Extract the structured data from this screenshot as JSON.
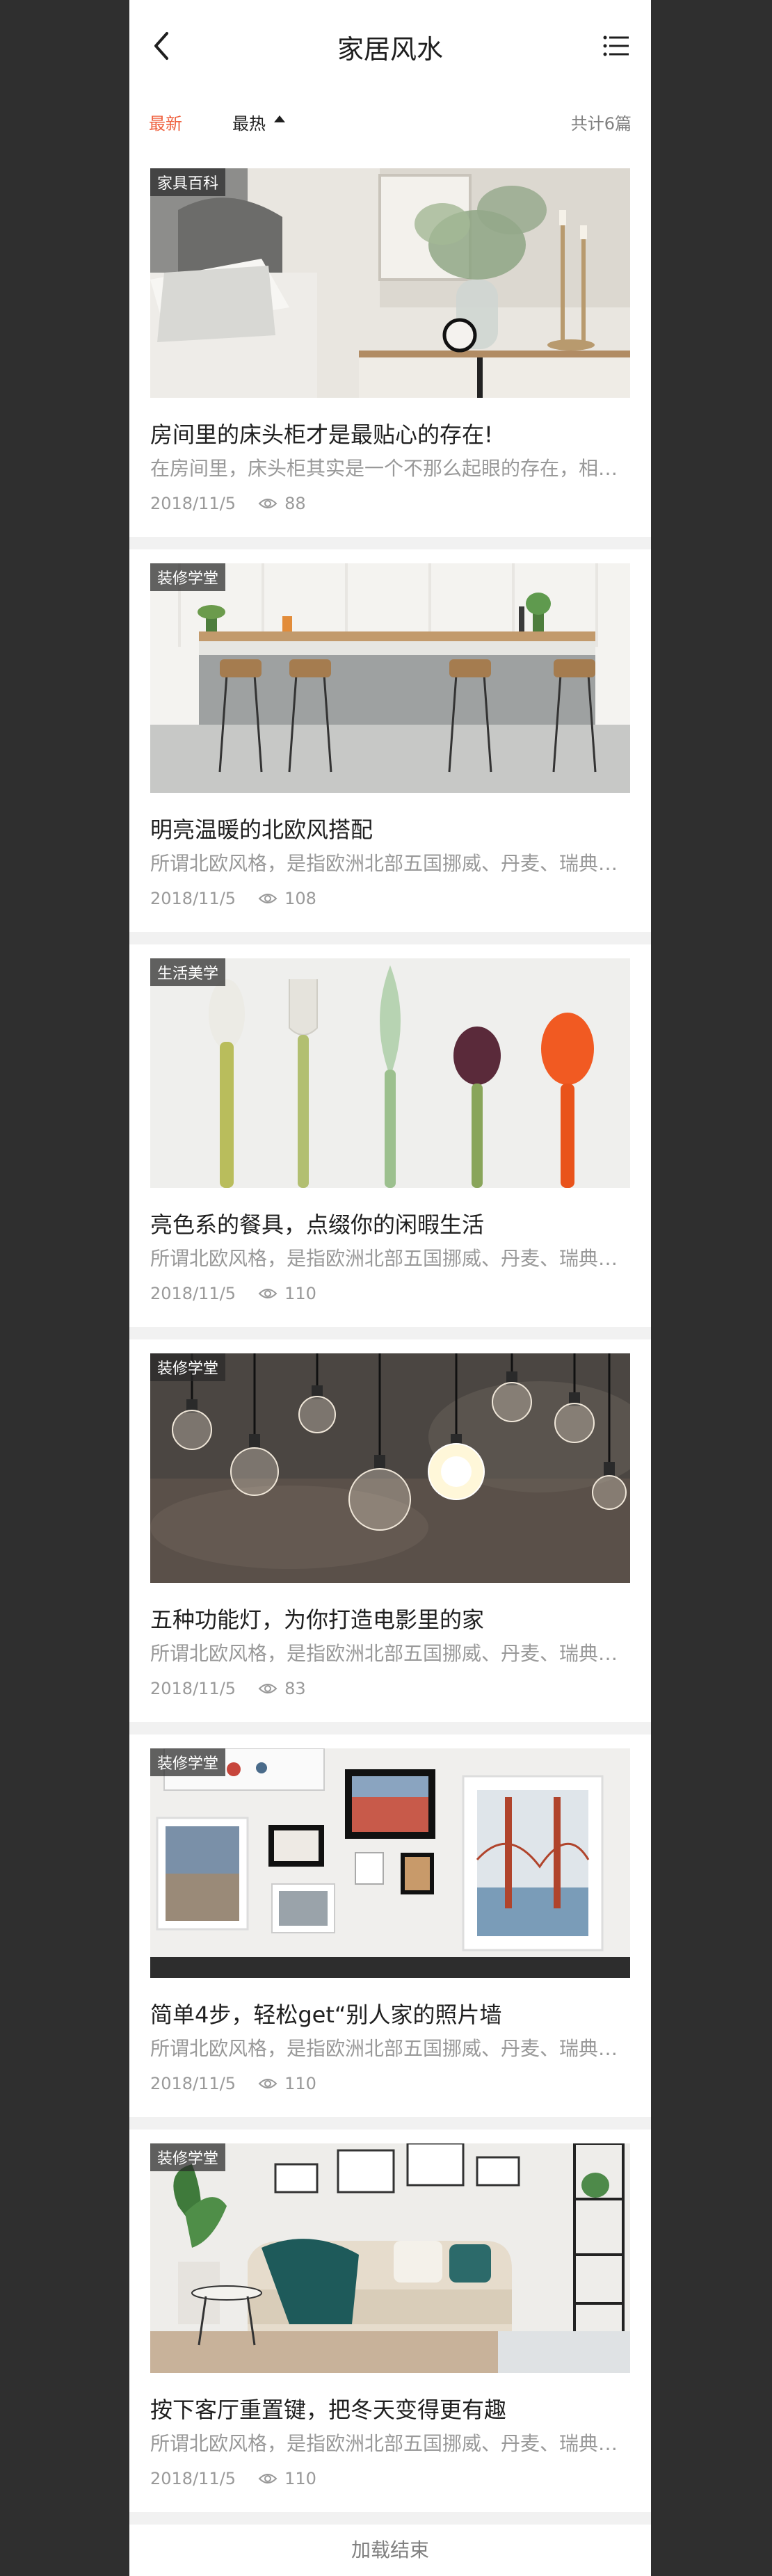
{
  "header": {
    "title": "家居风水",
    "back_icon": "chevron-left-icon",
    "menu_icon": "list-menu-icon"
  },
  "sortbar": {
    "latest": "最新",
    "hot": "最热",
    "count": "共计6篇"
  },
  "cards": [
    {
      "tag": "家具百科",
      "title": "房间里的床头柜才是最贴心的存在!",
      "desc": "在房间里，床头柜其实是一个不那么起眼的存在，相比于床、衣柜等大件家具",
      "date": "2018/11/5",
      "views": "88"
    },
    {
      "tag": "装修学堂",
      "title": "明亮温暖的北欧风搭配",
      "desc": "所谓北欧风格，是指欧洲北部五国挪威、丹麦、瑞典、芬兰和冰岛的室内设计风格",
      "date": "2018/11/5",
      "views": "108"
    },
    {
      "tag": "生活美学",
      "title": "亮色系的餐具，点缀你的闲暇生活",
      "desc": "所谓北欧风格，是指欧洲北部五国挪威、丹麦、瑞典、芬兰和冰岛的室内设计风格",
      "date": "2018/11/5",
      "views": "110"
    },
    {
      "tag": "装修学堂",
      "title": "五种功能灯，为你打造电影里的家",
      "desc": "所谓北欧风格，是指欧洲北部五国挪威、丹麦、瑞典、芬兰和冰岛的室内设计风格",
      "date": "2018/11/5",
      "views": "83"
    },
    {
      "tag": "装修学堂",
      "title": "简单4步，轻松get“别人家的照片墙",
      "desc": "所谓北欧风格，是指欧洲北部五国挪威、丹麦、瑞典、芬兰和冰岛的室内设计风格",
      "date": "2018/11/5",
      "views": "110"
    },
    {
      "tag": "装修学堂",
      "title": "按下客厅重置键，把冬天变得更有趣",
      "desc": "所谓北欧风格，是指欧洲北部五国挪威、丹麦、瑞典、芬兰和冰岛的室内设计风格",
      "date": "2018/11/5",
      "views": "110"
    }
  ],
  "footer": {
    "text": "加载结束"
  },
  "colors": {
    "accent": "#ef603e",
    "title": "#1f1f1f",
    "muted": "#999999",
    "count": "#808080"
  }
}
